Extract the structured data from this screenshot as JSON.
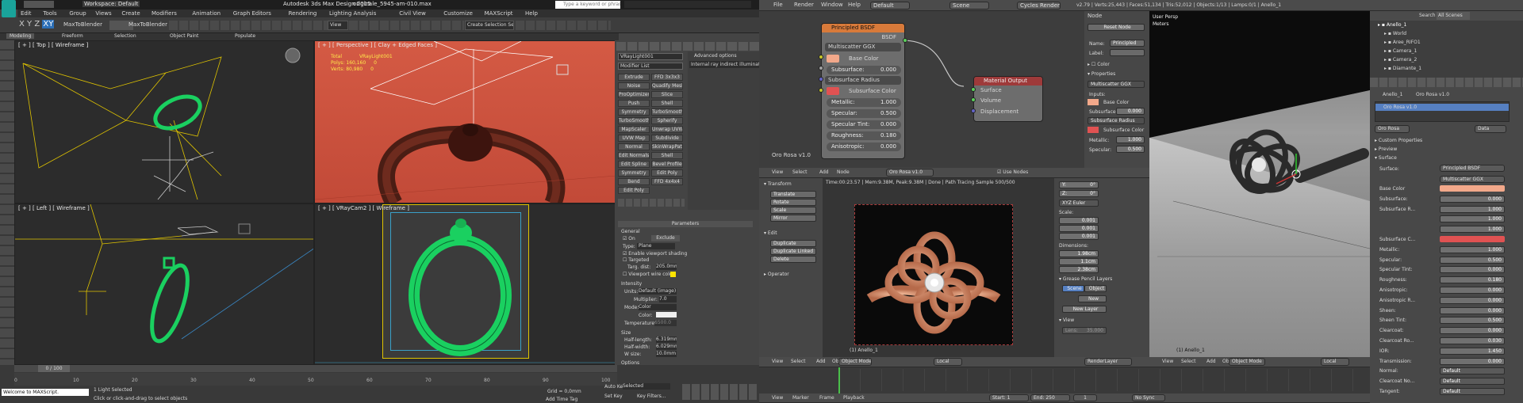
{
  "colors": {
    "max_accent": "#1aa39a",
    "wire_green": "#00d060",
    "red_bg": "#c8503a",
    "blender_node_header": "#d87a3a",
    "blender_select": "#5680c2"
  },
  "max": {
    "workspace": "Workspace: Default",
    "window_title": "Autodesk 3ds Max Design 2015",
    "filename": "originale_5945-am-010.max",
    "search_placeholder": "Type a keyword or phrase",
    "menu": [
      "Edit",
      "Tools",
      "Group",
      "Views",
      "Create",
      "Modifiers",
      "Animation",
      "Graph Editors",
      "Rendering",
      "Lighting Analysis",
      "Civil View",
      "Customize",
      "MAXScript",
      "Help"
    ],
    "toolbar": {
      "view_dropdown": "View",
      "selection_set": "Create Selection Se",
      "max_toolbar": "MaxToBlender"
    },
    "ribbon_tabs": [
      "Modeling",
      "Freeform",
      "Selection",
      "Object Paint",
      "Populate"
    ],
    "viewports": {
      "top": "[ + ] [ Top ] [ Wireframe ]",
      "perspective": "[ + ] [ Perspective ] [ Clay + Edged Faces ]",
      "left": "[ + ] [ Left ] [ Wireframe ]",
      "vraycam": "[ + ] [ VRayCam2 ] [ Wireframe ]"
    },
    "stats": {
      "total_label": "Total",
      "object_name": "VRayLight001",
      "polys_label": "Polys:",
      "polys_value": "160,160",
      "polys_obj": "0",
      "verts_label": "Verts:",
      "verts_value": "80,980",
      "verts_obj": "0"
    },
    "cmd": {
      "object_name": "VRayLight001",
      "modifier_list": "Modifier List",
      "modifiers": [
        [
          "Extrude",
          "FFD 3x3x3"
        ],
        [
          "Noise",
          "Quadify Mesh"
        ],
        [
          "ProOptimizer",
          "Slice"
        ],
        [
          "Push",
          "Shell"
        ],
        [
          "Symmetry",
          "TurboSmooth"
        ],
        [
          "TurboSmooth",
          "Spherify"
        ],
        [
          "MapScaler",
          "Unwrap UVW"
        ],
        [
          "UVW Map",
          "Subdivide"
        ],
        [
          "Normal",
          "SkinWrapPatch"
        ],
        [
          "Edit Normals",
          "Shell"
        ],
        [
          "Edit Spline",
          "Bevel Profile"
        ],
        [
          "Symmetry",
          "Edit Poly"
        ],
        [
          "Bend",
          "FFD 4x4x4"
        ],
        [
          "Edit Poly",
          ""
        ]
      ],
      "advanced_options": "Advanced options",
      "advanced_value": "Internal ray indirect illumination",
      "parameters": "Parameters",
      "general": "General",
      "on_label": "On",
      "exclude": "Exclude",
      "type_label": "Type:",
      "type_value": "Plane",
      "enable_shading": "Enable viewport shading",
      "targeted": "Targeted",
      "targ_dist_label": "Targ. dist:",
      "targ_dist_value": "205.0mm",
      "viewport_wire": "Viewport wire color",
      "intensity": "Intensity",
      "units_label": "Units:",
      "units_value": "Default (image)",
      "multiplier_label": "Multiplier:",
      "multiplier_value": "7.0",
      "mode_label": "Mode:",
      "mode_value": "Color",
      "color_label": "Color:",
      "temperature_label": "Temperature:",
      "temperature_value": "6500.0",
      "size": "Size",
      "half_length_label": "Half-length:",
      "half_length_value": "6.319mm",
      "half_width_label": "Half-width:",
      "half_width_value": "6.029mm",
      "w_size_label": "W size:",
      "w_size_value": "10.0mm",
      "options": "Options"
    },
    "timeline": {
      "frame": "0 / 100",
      "ticks": [
        "0",
        "10",
        "20",
        "30",
        "40",
        "50",
        "60",
        "70",
        "80",
        "90",
        "100"
      ]
    },
    "status": {
      "maxscript": "Welcome to MAXScript.",
      "selected": "1 Light Selected",
      "prompt": "Click or click-and-drag to select objects",
      "grid": "Grid = 0,0mm",
      "autokey": "Auto Key",
      "setkey": "Set Key",
      "selected_dd": "Selected",
      "keyfilters": "Key Filters...",
      "addtime": "Add Time Tag"
    }
  },
  "blender": {
    "info": {
      "menu": [
        "File",
        "Render",
        "Window",
        "Help"
      ],
      "layout": "Default",
      "scene": "Scene",
      "engine": "Cycles Render",
      "stats": "v2.79 | Verts:25,443 | Faces:51,134 | Tris:52,012 | Objects:1/13 | Lamps:0/1 | Anello_1"
    },
    "node": {
      "header": "Principled BSDF",
      "bsdf": "BSDF",
      "dist": "Multiscatter GGX",
      "base_color": "Base Color",
      "subsurface_label": "Subsurface:",
      "subsurface": "0.000",
      "subsurface_radius": "Subsurface Radius",
      "subsurface_color": "Subsurface Color",
      "metallic_label": "Metallic:",
      "metallic": "1.000",
      "specular_label": "Specular:",
      "specular": "0.500",
      "spec_tint_label": "Specular Tint:",
      "spec_tint": "0.000",
      "roughness_label": "Roughness:",
      "roughness": "0.180",
      "aniso_label": "Anisotropic:",
      "aniso": "0.000",
      "output_header": "Material Output",
      "out_surface": "Surface",
      "out_volume": "Volume",
      "out_disp": "Displacement",
      "material_name": "Oro Rosa v1.0"
    },
    "node_header": {
      "items": [
        "View",
        "Select",
        "Add",
        "Node"
      ],
      "material": "Oro Rosa v1.0",
      "use_nodes": "Use Nodes"
    },
    "node_panel": {
      "title": "Node",
      "reset": "Reset Node",
      "name_label": "Name:",
      "name": "Principled",
      "label_label": "Label:",
      "color": "Color",
      "properties": "Properties",
      "dist": "Multiscatter GGX",
      "inputs": "Inputs:",
      "base_color": "Base Color",
      "subsurface": "Subsurface:",
      "subsurface_val": "0.000",
      "subsurface_radius": "Subsurface Radius",
      "subsurface_color": "Subsurface Color",
      "metallic": "Metallic:",
      "metallic_val": "1.000",
      "specular": "Specular:",
      "specular_val": "0.500"
    },
    "render": {
      "status": "Time:00:23.57 | Mem:9.38M, Peak:9.38M | Done | Path Tracing Sample 500/500",
      "caption": "(1) Anello_1"
    },
    "tools": {
      "transform": "Transform",
      "items": [
        "Translate",
        "Rotate",
        "Scale",
        "Mirror"
      ],
      "edit": "Edit",
      "edit_items": [
        "Duplicate",
        "Duplicate Linked",
        "Delete"
      ],
      "operator": "Operator"
    },
    "npanel": {
      "y_label": "Y:",
      "y": "0°",
      "z_label": "Z:",
      "z": "0°",
      "euler": "XYZ Euler",
      "scale": "Scale:",
      "sx": "0.001",
      "sy": "0.001",
      "sz": "0.001",
      "dims": "Dimensions:",
      "dx": "1.98cm",
      "dy": "1.1cm",
      "dz": "2.38cm",
      "grease": "Grease Pencil Layers",
      "scene_btn": "Scene",
      "object_btn": "Object",
      "new": "New",
      "new_layer": "New Layer",
      "view": "View",
      "lens": "Lens:",
      "lens_val": "35.000"
    },
    "view3d": {
      "label": "User Persp",
      "units": "Meters",
      "caption": "(1) Anello_1",
      "mode": "Object Mode",
      "orient": "Local",
      "renderlayer": "RenderLayer"
    },
    "outliner": {
      "search": "Search",
      "scenes": "All Scenes",
      "items": [
        "Anello_1",
        "World",
        "Aree_RIFO1",
        "Camera_1",
        "Camera_2",
        "Diamante_1"
      ]
    },
    "props": {
      "object": "Anello_1",
      "material": "Oro Rosa v1.0",
      "slot": "Oro Rosa",
      "data": "Data",
      "sections": [
        "Custom Properties",
        "Preview",
        "Surface"
      ],
      "surface_label": "Surface:",
      "surface_value": "Principled BSDF",
      "dist": "Multiscatter GGX",
      "fields": [
        [
          "Base Color",
          ""
        ],
        [
          "Subsurface:",
          "0.000"
        ],
        [
          "Subsurface R...",
          "1.000"
        ],
        [
          "",
          "1.000"
        ],
        [
          "",
          "1.000"
        ],
        [
          "Subsurface C...",
          ""
        ],
        [
          "Metallic:",
          "1.000"
        ],
        [
          "Specular:",
          "0.500"
        ],
        [
          "Specular Tint:",
          "0.000"
        ],
        [
          "Roughness:",
          "0.180"
        ],
        [
          "Anisotropic:",
          "0.000"
        ],
        [
          "Anisotropic R...",
          "0.000"
        ],
        [
          "Sheen:",
          "0.000"
        ],
        [
          "Sheen Tint:",
          "0.500"
        ],
        [
          "Clearcoat:",
          "0.000"
        ],
        [
          "Clearcoat Ro...",
          "0.030"
        ],
        [
          "IOR:",
          "1.450"
        ],
        [
          "Transmission:",
          "0.000"
        ],
        [
          "Normal:",
          "Default"
        ],
        [
          "Clearcoat No...",
          "Default"
        ],
        [
          "Tangent:",
          "Default"
        ]
      ]
    },
    "timeline": {
      "items": [
        "View",
        "Marker",
        "Frame",
        "Playback"
      ],
      "start_label": "Start:",
      "start": "1",
      "end_label": "End:",
      "end": "250",
      "current": "1",
      "sync": "No Sync"
    }
  }
}
